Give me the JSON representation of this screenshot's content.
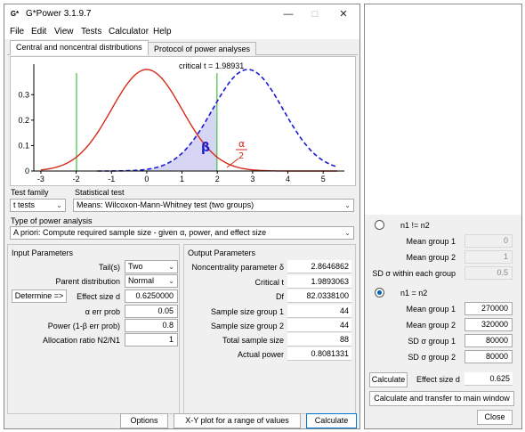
{
  "window": {
    "title": "G*Power 3.1.9.7",
    "app_icon": "G*"
  },
  "menu": [
    "File",
    "Edit",
    "View",
    "Tests",
    "Calculator",
    "Help"
  ],
  "tabs": [
    "Central and noncentral distributions",
    "Protocol of power analyses"
  ],
  "plot": {
    "critical_label": "critical t = 1.98931",
    "beta_label": "β",
    "alpha_num": "α",
    "alpha_den": "2",
    "x_ticks": [
      "-3",
      "-2",
      "-1",
      "0",
      "1",
      "2",
      "3",
      "4",
      "5"
    ],
    "y_ticks": [
      "0",
      "0.1",
      "0.2",
      "0.3"
    ],
    "colors": {
      "central": "#d42a1a",
      "noncentral": "#1a1ad4",
      "critical": "#40c040",
      "beta_fill": "#d6d6f4"
    }
  },
  "chart_data": {
    "type": "line",
    "series": [
      {
        "kind": "central t (H0)",
        "mean": 0,
        "sd": 1.0
      },
      {
        "kind": "noncentral t (H1)",
        "mean": 2.8646862,
        "sd": 1.0
      }
    ],
    "critical_values": [
      -1.98931,
      1.98931
    ],
    "xlim": [
      -3.2,
      5.6
    ],
    "ylim": [
      0,
      0.42
    ]
  },
  "test_family": {
    "label": "Test family",
    "value": "t tests"
  },
  "statistical_test": {
    "label": "Statistical test",
    "value": "Means: Wilcoxon-Mann-Whitney test (two groups)"
  },
  "power_analysis": {
    "label": "Type of power analysis",
    "value": "A priori: Compute required sample size - given α, power, and effect size"
  },
  "input": {
    "title": "Input Parameters",
    "tails_label": "Tail(s)",
    "tails_value": "Two",
    "parent_label": "Parent distribution",
    "parent_value": "Normal",
    "determine_label": "Determine =>",
    "effect_label": "Effect size d",
    "effect_value": "0.6250000",
    "alpha_label": "α err prob",
    "alpha_value": "0.05",
    "power_label": "Power (1-β err prob)",
    "power_value": "0.8",
    "ratio_label": "Allocation ratio N2/N1",
    "ratio_value": "1"
  },
  "output": {
    "title": "Output Parameters",
    "rows": [
      {
        "label": "Noncentrality parameter δ",
        "value": "2.8646862"
      },
      {
        "label": "Critical t",
        "value": "1.9893063"
      },
      {
        "label": "Df",
        "value": "82.0338100"
      },
      {
        "label": "Sample size group 1",
        "value": "44"
      },
      {
        "label": "Sample size group 2",
        "value": "44"
      },
      {
        "label": "Total sample size",
        "value": "88"
      },
      {
        "label": "Actual power",
        "value": "0.8081331"
      }
    ]
  },
  "buttons": {
    "options": "Options",
    "xy_plot": "X-Y plot for a range of values",
    "calculate": "Calculate"
  },
  "side": {
    "option1": "n1 != n2",
    "option2": "n1 = n2",
    "unequal": [
      {
        "label": "Mean group 1",
        "value": "0"
      },
      {
        "label": "Mean group 2",
        "value": "1"
      },
      {
        "label": "SD σ within each group",
        "value": "0.5"
      }
    ],
    "equal": [
      {
        "label": "Mean group 1",
        "value": "270000"
      },
      {
        "label": "Mean group 2",
        "value": "320000"
      },
      {
        "label": "SD σ group 1",
        "value": "80000"
      },
      {
        "label": "SD σ group 2",
        "value": "80000"
      }
    ],
    "calculate": "Calculate",
    "effect_label": "Effect size d",
    "effect_value": "0.625",
    "transfer": "Calculate and transfer to main window",
    "close": "Close"
  }
}
